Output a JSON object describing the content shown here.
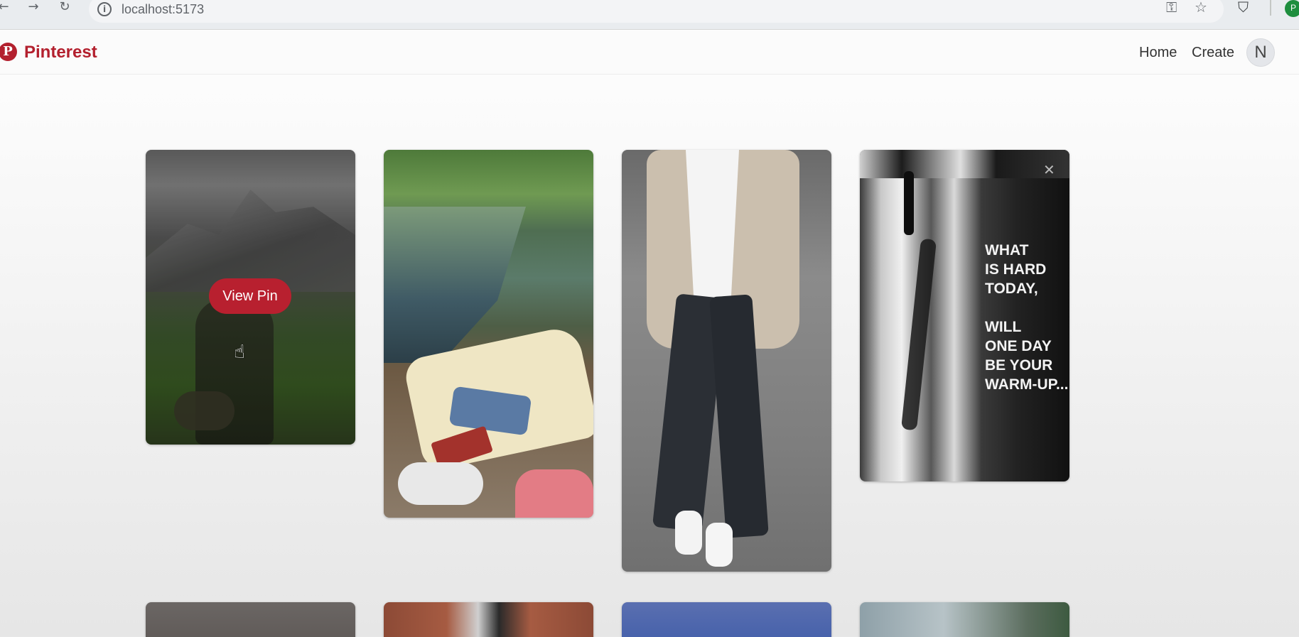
{
  "browser": {
    "url": "localhost:5173",
    "back_glyph": "←",
    "forward_glyph": "→",
    "reload_glyph": "↻",
    "info_glyph": "i",
    "key_glyph": "⚿",
    "star_glyph": "☆",
    "extensions_glyph": "⛉",
    "profile_initial": "P"
  },
  "header": {
    "logo_text": "Pinterest",
    "logo_glyph": "P",
    "nav": [
      "Home",
      "Create"
    ],
    "avatar_initial": "N"
  },
  "pins": [
    {
      "id": "pin-1",
      "hover_label": "View Pin",
      "subject": "hiker in misty mountains"
    },
    {
      "id": "pin-2",
      "subject": "riverside picnic"
    },
    {
      "id": "pin-3",
      "subject": "man in beige blazer"
    },
    {
      "id": "pin-4",
      "subject": "dancer shadow quote",
      "quote": "WHAT\nIS HARD\nTODAY,\n\nWILL\nONE DAY\nBE YOUR\nWARM-UP..."
    }
  ],
  "colors": {
    "brand": "#b3202e",
    "view_pin_button": "#b8202f"
  },
  "icons": {
    "cursor": "hand-cursor-icon",
    "close": "close-icon"
  }
}
